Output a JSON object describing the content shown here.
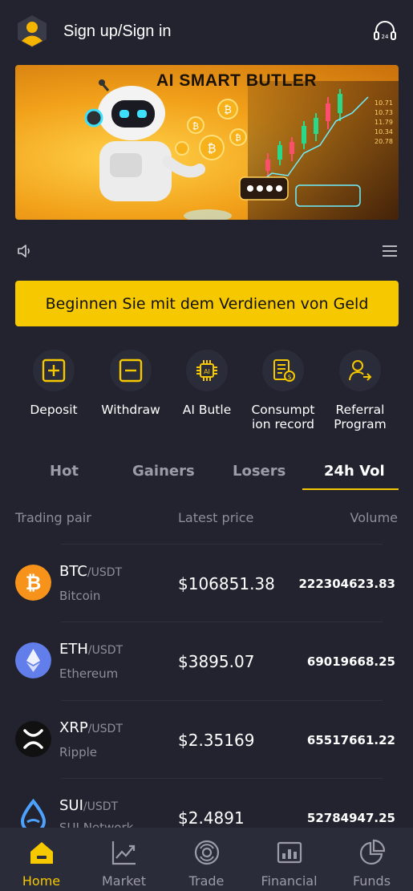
{
  "header": {
    "signin_label": "Sign up/Sign in"
  },
  "banner": {
    "title": "AI SMART BUTLER"
  },
  "cta": {
    "label": "Beginnen Sie mit dem Verdienen von Geld"
  },
  "quick_actions": [
    {
      "label": "Deposit",
      "icon": "plus-square-icon"
    },
    {
      "label": "Withdraw",
      "icon": "minus-square-icon"
    },
    {
      "label": "AI Butle",
      "icon": "ai-chip-icon"
    },
    {
      "label": "Consumpt\nion record",
      "icon": "receipt-icon"
    },
    {
      "label": "Referral\nProgram",
      "icon": "referral-icon"
    }
  ],
  "tabs": [
    {
      "label": "Hot"
    },
    {
      "label": "Gainers"
    },
    {
      "label": "Losers"
    },
    {
      "label": "24h Vol",
      "active": true
    }
  ],
  "table": {
    "headers": {
      "pair": "Trading pair",
      "price": "Latest price",
      "volume": "Volume"
    },
    "rows": [
      {
        "symbol": "BTC",
        "quote": "/USDT",
        "name": "Bitcoin",
        "price": "$106851.38",
        "volume": "222304623.83",
        "color": "#f7931a"
      },
      {
        "symbol": "ETH",
        "quote": "/USDT",
        "name": "Ethereum",
        "price": "$3895.07",
        "volume": "69019668.25",
        "color": "#627eea"
      },
      {
        "symbol": "XRP",
        "quote": "/USDT",
        "name": "Ripple",
        "price": "$2.35169",
        "volume": "65517661.22",
        "color": "#111111"
      },
      {
        "symbol": "SUI",
        "quote": "/USDT",
        "name": "SUI Network",
        "price": "$2.4891",
        "volume": "52784947.25",
        "color": "#4da2ff"
      }
    ]
  },
  "bottom_nav": [
    {
      "label": "Home",
      "active": true
    },
    {
      "label": "Market"
    },
    {
      "label": "Trade"
    },
    {
      "label": "Financial"
    },
    {
      "label": "Funds"
    }
  ],
  "colors": {
    "accent": "#f5c800",
    "background": "#22232f",
    "nav_bg": "#2b2c39"
  }
}
